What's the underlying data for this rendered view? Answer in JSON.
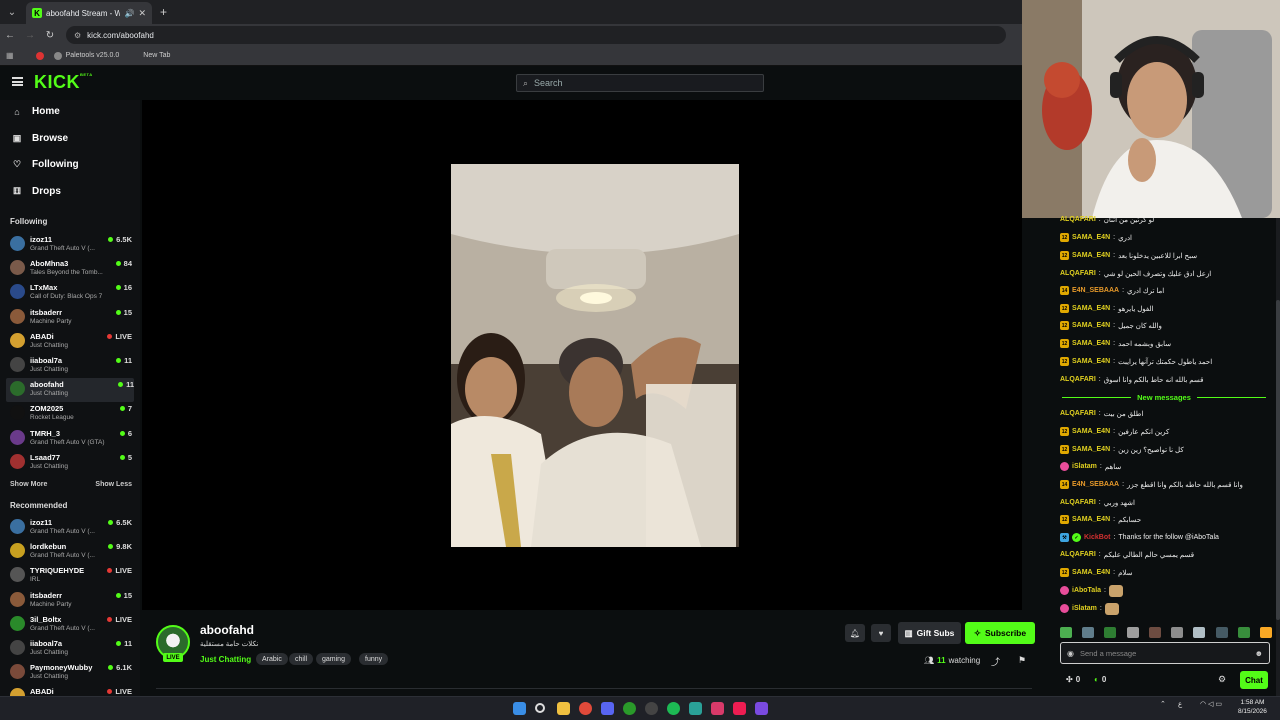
{
  "browser": {
    "tab_title": "aboofahd Stream - Watch L",
    "url": "kick.com/aboofahd",
    "bookmarks": [
      "Paletools v25.0.0",
      "New Tab"
    ]
  },
  "header": {
    "logo": "KICK",
    "logo_badge": "BETA",
    "search_placeholder": "Search"
  },
  "sidebar": {
    "nav": [
      {
        "label": "Home",
        "icon": "home-icon"
      },
      {
        "label": "Browse",
        "icon": "browse-icon"
      },
      {
        "label": "Following",
        "icon": "heart-icon"
      },
      {
        "label": "Drops",
        "icon": "drops-icon"
      }
    ],
    "following_title": "Following",
    "following": [
      {
        "name": "izoz11",
        "game": "Grand Theft Auto V (...",
        "viewers": "6.5K",
        "color": "#3a6fa0"
      },
      {
        "name": "AboMhna3",
        "game": "Tales Beyond the Tomb...",
        "viewers": "84",
        "color": "#7a5a4a"
      },
      {
        "name": "LTxMax",
        "game": "Call of Duty: Black Ops 7",
        "viewers": "16",
        "color": "#2a4a8a"
      },
      {
        "name": "itsbaderr",
        "game": "Machine Party",
        "viewers": "15",
        "color": "#8a5a3a"
      },
      {
        "name": "ABADi",
        "game": "Just Chatting",
        "viewers": "LIVE",
        "color": "#d4a030"
      },
      {
        "name": "iiaboal7a",
        "game": "Just Chatting",
        "viewers": "11",
        "color": "#444"
      },
      {
        "name": "aboofahd",
        "game": "Just Chatting",
        "viewers": "11",
        "color": "#2b6b2b"
      },
      {
        "name": "ZOM2025",
        "game": "Rocket League",
        "viewers": "7",
        "color": "#111"
      },
      {
        "name": "TMRH_3",
        "game": "Grand Theft Auto V (GTA)",
        "viewers": "6",
        "color": "#6a3a8a"
      },
      {
        "name": "Lsaad77",
        "game": "Just Chatting",
        "viewers": "5",
        "color": "#a03030"
      }
    ],
    "show_more": "Show More",
    "show_less": "Show Less",
    "recommended_title": "Recommended",
    "recommended": [
      {
        "name": "izoz11",
        "game": "Grand Theft Auto V (...",
        "viewers": "6.5K",
        "color": "#3a6fa0"
      },
      {
        "name": "lordkebun",
        "game": "Grand Theft Auto V (...",
        "viewers": "9.8K",
        "color": "#c8a020"
      },
      {
        "name": "TYRIQUEHYDE",
        "game": "IRL",
        "viewers": "LIVE",
        "color": "#555"
      },
      {
        "name": "itsbaderr",
        "game": "Machine Party",
        "viewers": "15",
        "color": "#8a5a3a"
      },
      {
        "name": "3il_Boltx",
        "game": "Grand Theft Auto V (...",
        "viewers": "LIVE",
        "color": "#2a8a2a"
      },
      {
        "name": "iiaboal7a",
        "game": "Just Chatting",
        "viewers": "11",
        "color": "#444"
      },
      {
        "name": "PaymoneyWubby",
        "game": "Just Chatting",
        "viewers": "6.1K",
        "color": "#7a4a3a"
      },
      {
        "name": "ABADi",
        "game": "",
        "viewers": "LIVE",
        "color": "#d4a030"
      }
    ]
  },
  "stream": {
    "channel": "aboofahd",
    "title": "نكلات حامة مستقلية",
    "category": "Just Chatting",
    "tags": [
      "Arabic",
      "chill",
      "gaming",
      "funny"
    ],
    "live_label": "LIVE",
    "gift_label": "Gift Subs",
    "subscribe_label": "Subscribe",
    "watching_count": "11",
    "watching_label": "watching"
  },
  "chat": {
    "new_messages_label": "New messages",
    "messages": [
      {
        "user": "ALQAFARI",
        "color": "#e0d020",
        "badge": "",
        "text": "لو كرتين من اثنان"
      },
      {
        "user": "SAMA_E4N",
        "color": "#e0d020",
        "badge": "12",
        "text": "ادري"
      },
      {
        "user": "SAMA_E4N",
        "color": "#e0d020",
        "badge": "12",
        "text": "سبح ابرا للاعبين يدخلونا بعد"
      },
      {
        "user": "ALQAFARI",
        "color": "#e0d020",
        "badge": "",
        "text": "ازعل ادق عليك وتصرف الحين لو شي"
      },
      {
        "user": "E4N_SEBAAA",
        "color": "#e89a2a",
        "badge": "14",
        "text": "اما ترك ادري"
      },
      {
        "user": "SAMA_E4N",
        "color": "#e0d020",
        "badge": "12",
        "text": "الفول يايرهو"
      },
      {
        "user": "SAMA_E4N",
        "color": "#e0d020",
        "badge": "12",
        "text": "والله كان جميل"
      },
      {
        "user": "SAMA_E4N",
        "color": "#e0d020",
        "badge": "12",
        "text": "سابق وبشمه احمد"
      },
      {
        "user": "SAMA_E4N",
        "color": "#e0d020",
        "badge": "12",
        "text": "احمد ياطول حكمتك ترآنها يرايبت"
      },
      {
        "user": "ALQAFARI",
        "color": "#e0d020",
        "badge": "",
        "text": "قسم بالله انه حاط بالكم وانا اسوق"
      },
      {
        "user": "ALQAFARI",
        "color": "#e0d020",
        "badge": "",
        "text": "اطلق من بيت"
      },
      {
        "user": "SAMA_E4N",
        "color": "#e0d020",
        "badge": "12",
        "text": "كرين انكم عارفين"
      },
      {
        "user": "SAMA_E4N",
        "color": "#e0d020",
        "badge": "12",
        "text": "كل نا تواصيح؟ زين زين"
      },
      {
        "user": "iSlatam",
        "color": "#e0d020",
        "badge": "pink",
        "text": "ساهم"
      },
      {
        "user": "E4N_SEBAAA",
        "color": "#e89a2a",
        "badge": "14",
        "text": "وانا قسم بالله حاطه بالكم وانا اقطع جزر"
      },
      {
        "user": "ALQAFARI",
        "color": "#e0d020",
        "badge": "",
        "text": "اشهد وربي"
      },
      {
        "user": "SAMA_E4N",
        "color": "#e0d020",
        "badge": "12",
        "text": "حسابكم"
      },
      {
        "user": "KickBot",
        "color": "#d03030",
        "badge": "bot",
        "text": "Thanks for the follow @iAboTala"
      },
      {
        "user": "ALQAFARI",
        "color": "#e0d020",
        "badge": "",
        "text": "قسم يمسي حالم الطالي عليكم"
      },
      {
        "user": "SAMA_E4N",
        "color": "#e0d020",
        "badge": "12",
        "text": "سلام"
      },
      {
        "user": "iAboTala",
        "color": "#e0d020",
        "badge": "pink",
        "text": ""
      },
      {
        "user": "iSlatam",
        "color": "#e0d020",
        "badge": "pink",
        "text": ""
      }
    ],
    "input_placeholder": "Send a message",
    "footer_left_count": "0",
    "footer_right_count": "0",
    "chat_button": "Chat"
  },
  "taskbar": {
    "time": "1:58 AM",
    "date": "8/15/2026"
  },
  "colors": {
    "accent": "#53fc18",
    "background": "#0b0e0f"
  }
}
